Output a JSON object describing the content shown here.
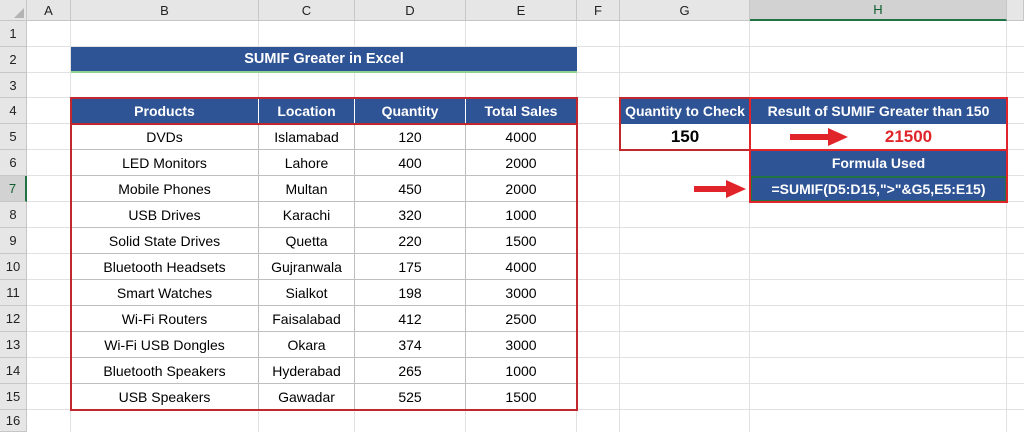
{
  "sheet": {
    "columns": [
      "A",
      "B",
      "C",
      "D",
      "E",
      "F",
      "G",
      "H"
    ],
    "rows": [
      "1",
      "2",
      "3",
      "4",
      "5",
      "6",
      "7",
      "8",
      "9",
      "10",
      "11",
      "12",
      "13",
      "14",
      "15",
      "16"
    ]
  },
  "title": "SUMIF Greater in Excel",
  "table": {
    "headers": [
      "Products",
      "Location",
      "Quantity",
      "Total Sales"
    ],
    "rows": [
      [
        "DVDs",
        "Islamabad",
        "120",
        "4000"
      ],
      [
        "LED Monitors",
        "Lahore",
        "400",
        "2000"
      ],
      [
        "Mobile Phones",
        "Multan",
        "450",
        "2000"
      ],
      [
        "USB Drives",
        "Karachi",
        "320",
        "1000"
      ],
      [
        "Solid State Drives",
        "Quetta",
        "220",
        "1500"
      ],
      [
        "Bluetooth Headsets",
        "Gujranwala",
        "175",
        "4000"
      ],
      [
        "Smart Watches",
        "Sialkot",
        "198",
        "3000"
      ],
      [
        "Wi-Fi Routers",
        "Faisalabad",
        "412",
        "2500"
      ],
      [
        "Wi-Fi USB Dongles",
        "Okara",
        "374",
        "3000"
      ],
      [
        "Bluetooth Speakers",
        "Hyderabad",
        "265",
        "1000"
      ],
      [
        "USB Speakers",
        "Gawadar",
        "525",
        "1500"
      ]
    ]
  },
  "side": {
    "check_header": "Quantity to Check",
    "result_header": "Result of SUMIF Greater than 150",
    "check_value": "150",
    "result_value": "21500",
    "formula_header": "Formula Used",
    "formula": "=SUMIF(D5:D15,\">\"&G5,E5:E15)"
  },
  "colors": {
    "header_fill": "#2f5496",
    "accent_red": "#e0242a",
    "selection_green": "#217346"
  },
  "icons": [
    "arrow-right-icon",
    "arrow-right-icon"
  ]
}
